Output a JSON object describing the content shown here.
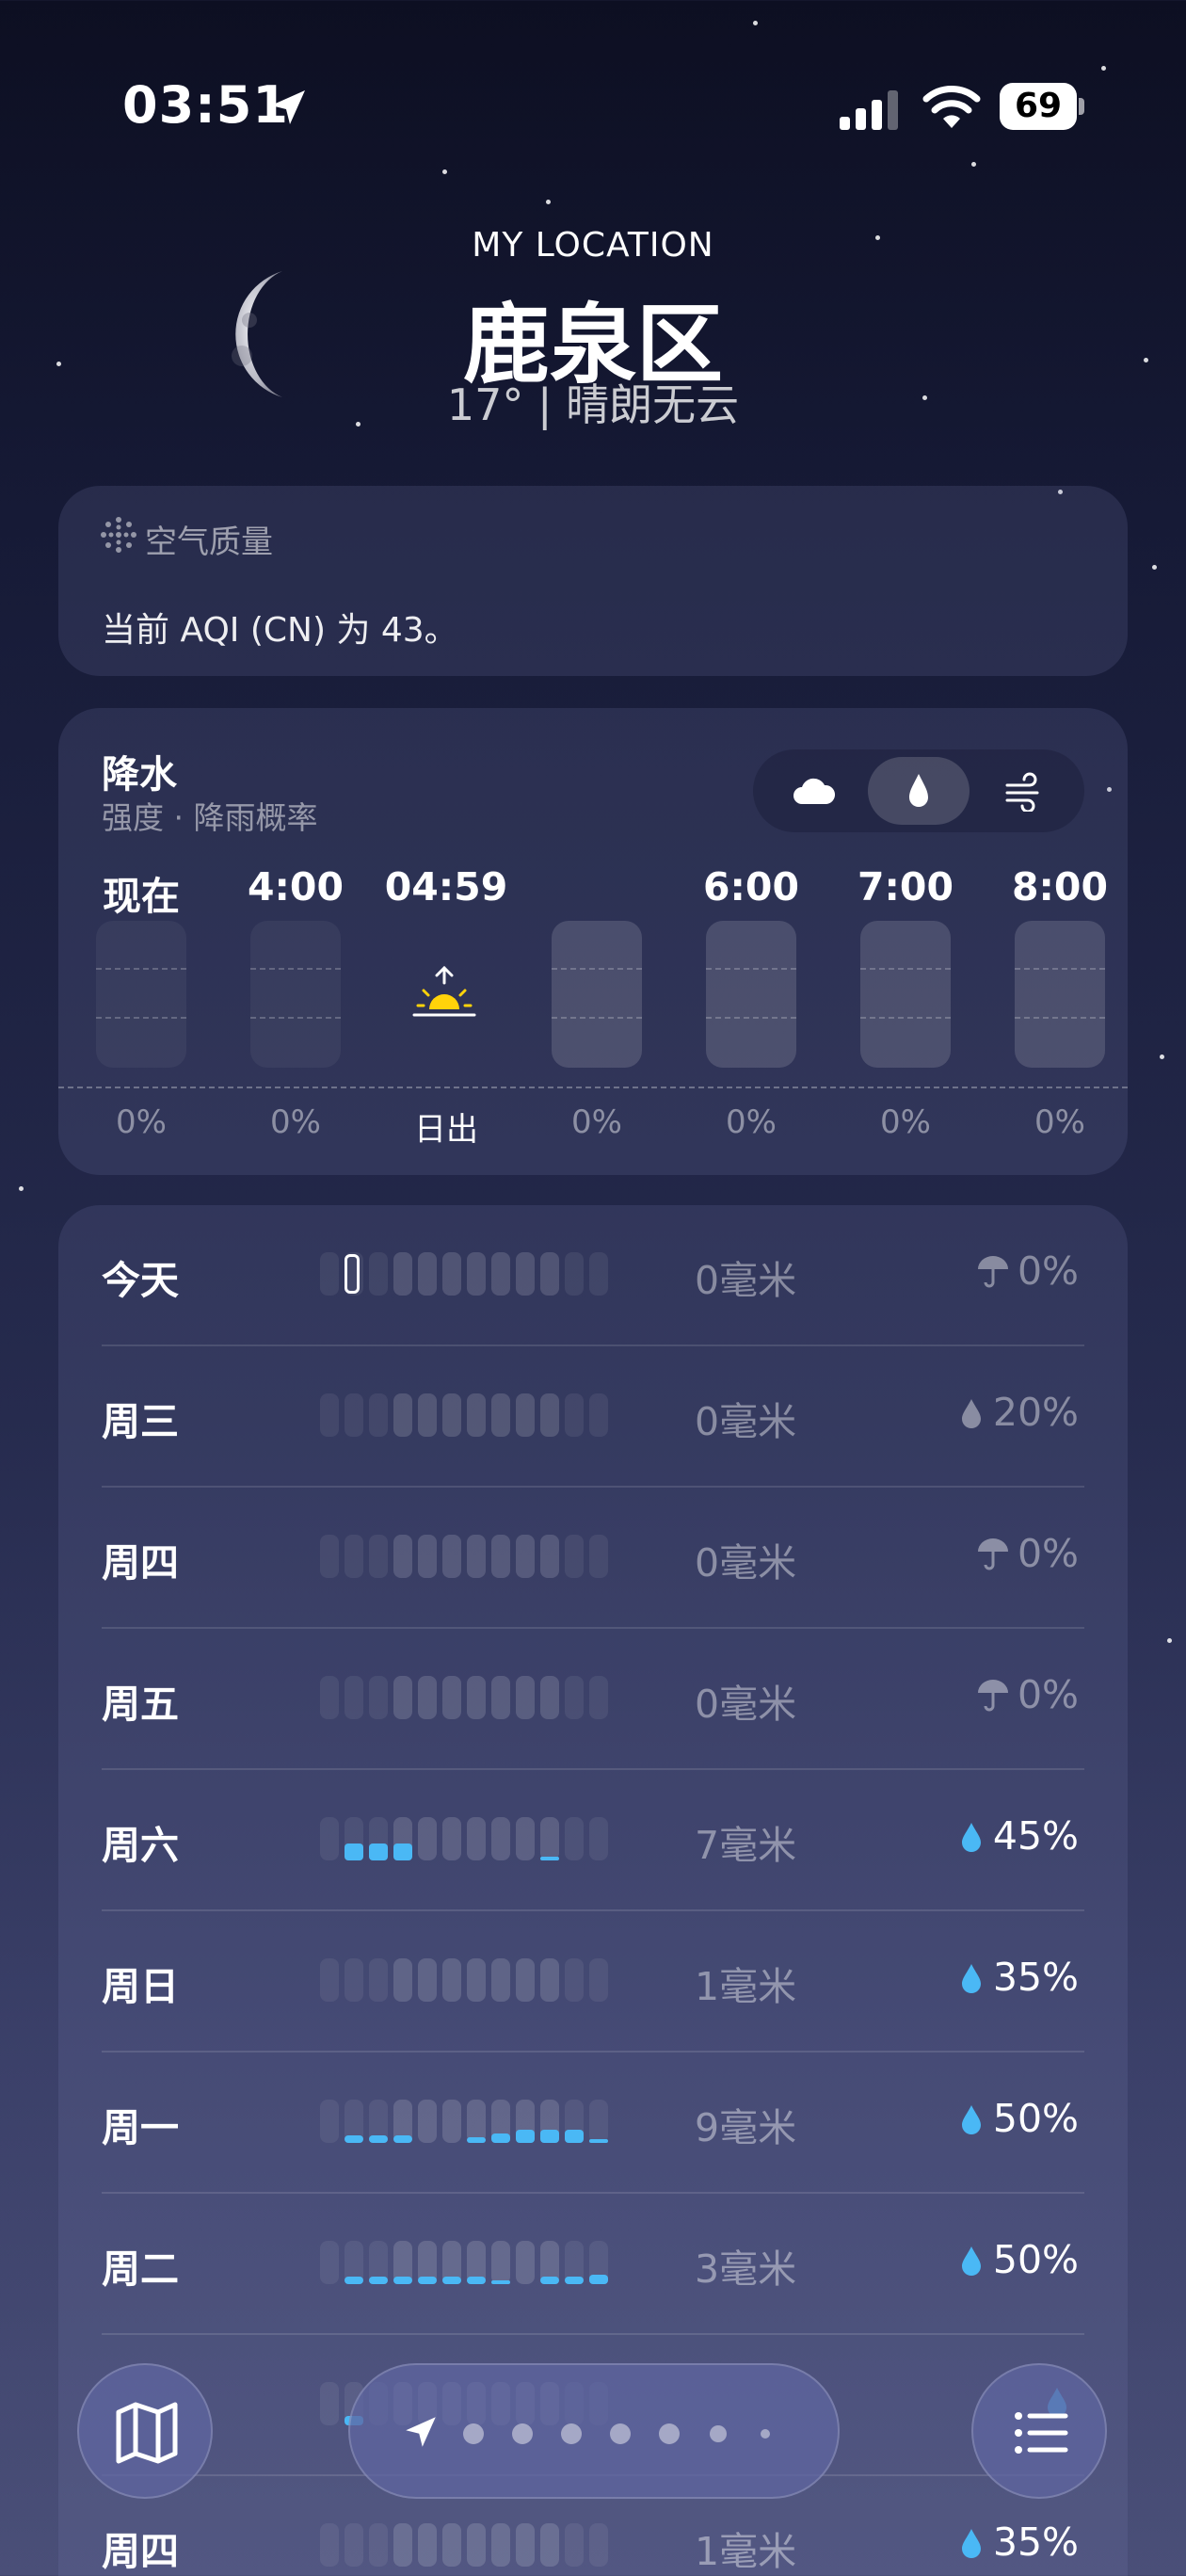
{
  "status_bar": {
    "time": "03:51",
    "battery": "69"
  },
  "header": {
    "location_label": "MY LOCATION",
    "city": "鹿泉区",
    "temp_condition": "17°  |  晴朗无云"
  },
  "air_quality": {
    "title": "空气质量",
    "text": "当前 AQI (CN) 为 43。"
  },
  "precipitation": {
    "title": "降水",
    "subtitle": "强度 · 降雨概率",
    "hours": [
      {
        "label": "现在",
        "value": "0%"
      },
      {
        "label": "4:00",
        "value": "0%"
      },
      {
        "label": "04:59",
        "value": "日出"
      },
      {
        "label": "",
        "value": "0%"
      },
      {
        "label": "6:00",
        "value": "0%"
      },
      {
        "label": "7:00",
        "value": "0%"
      },
      {
        "label": "8:00",
        "value": "0%"
      }
    ],
    "modes": [
      "cloud-icon",
      "raindrop-icon",
      "wind-icon"
    ],
    "active_mode": "raindrop-icon"
  },
  "daily": [
    {
      "day": "今天",
      "amount": "0毫米",
      "chance": "0%",
      "icon": "umbrella-icon"
    },
    {
      "day": "周三",
      "amount": "0毫米",
      "chance": "20%",
      "icon": "raindrop-icon"
    },
    {
      "day": "周四",
      "amount": "0毫米",
      "chance": "0%",
      "icon": "umbrella-icon"
    },
    {
      "day": "周五",
      "amount": "0毫米",
      "chance": "0%",
      "icon": "umbrella-icon"
    },
    {
      "day": "周六",
      "amount": "7毫米",
      "chance": "45%",
      "icon": "raindrop-icon"
    },
    {
      "day": "周日",
      "amount": "1毫米",
      "chance": "35%",
      "icon": "raindrop-icon"
    },
    {
      "day": "周一",
      "amount": "9毫米",
      "chance": "50%",
      "icon": "raindrop-icon"
    },
    {
      "day": "周二",
      "amount": "3毫米",
      "chance": "50%",
      "icon": "raindrop-icon"
    },
    {
      "day": "",
      "amount": "",
      "chance": "",
      "icon": "raindrop-icon"
    },
    {
      "day": "周四",
      "amount": "1毫米",
      "chance": "35%",
      "icon": "raindrop-icon"
    }
  ],
  "accent_color": "#4ab8f5",
  "toolbar": {
    "left": "map-icon",
    "right": "list-icon",
    "page_count": 7,
    "current": 0
  }
}
